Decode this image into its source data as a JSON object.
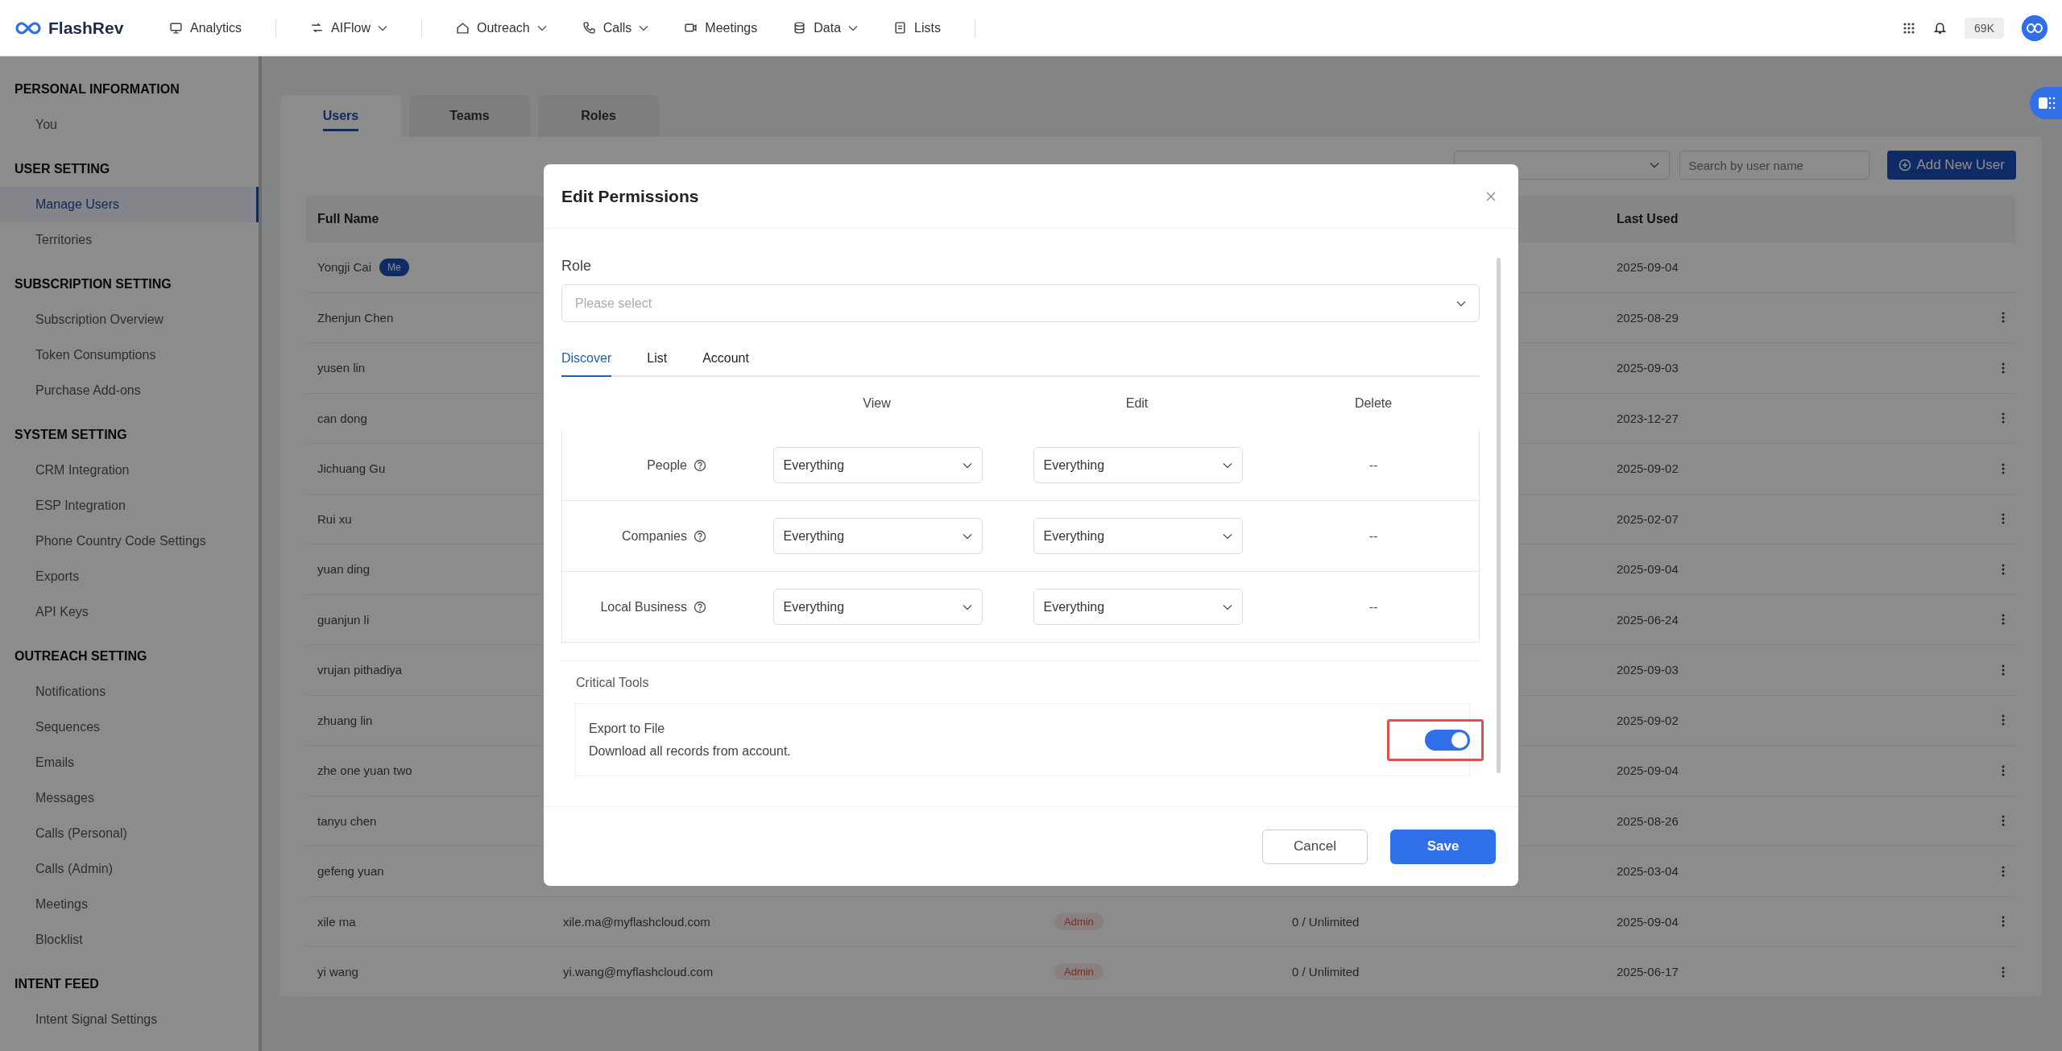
{
  "app": {
    "name": "FlashRev"
  },
  "nav": [
    {
      "kind": "monitor",
      "label": "Analytics",
      "dropdown": false,
      "divider_after": true
    },
    {
      "kind": "flow",
      "label": "AIFlow",
      "dropdown": true,
      "divider_after": true
    },
    {
      "kind": "house",
      "label": "Outreach",
      "dropdown": true,
      "divider_after": false
    },
    {
      "kind": "phone",
      "label": "Calls",
      "dropdown": true,
      "divider_after": false
    },
    {
      "kind": "video",
      "label": "Meetings",
      "dropdown": false,
      "divider_after": false
    },
    {
      "kind": "database",
      "label": "Data",
      "dropdown": true,
      "divider_after": false
    },
    {
      "kind": "list",
      "label": "Lists",
      "dropdown": false,
      "divider_after": true
    }
  ],
  "credits": "69K",
  "sidebar": [
    {
      "title": "PERSONAL INFORMATION",
      "items": [
        {
          "label": "You",
          "selected": false
        }
      ]
    },
    {
      "title": "USER SETTING",
      "items": [
        {
          "label": "Manage Users",
          "selected": true
        },
        {
          "label": "Territories",
          "selected": false
        }
      ]
    },
    {
      "title": "SUBSCRIPTION SETTING",
      "items": [
        {
          "label": "Subscription Overview",
          "selected": false
        },
        {
          "label": "Token Consumptions",
          "selected": false
        },
        {
          "label": "Purchase Add-ons",
          "selected": false
        }
      ]
    },
    {
      "title": "SYSTEM SETTING",
      "items": [
        {
          "label": "CRM Integration",
          "selected": false
        },
        {
          "label": "ESP Integration",
          "selected": false
        },
        {
          "label": "Phone Country Code Settings",
          "selected": false
        },
        {
          "label": "Exports",
          "selected": false
        },
        {
          "label": "API Keys",
          "selected": false
        }
      ]
    },
    {
      "title": "OUTREACH SETTING",
      "items": [
        {
          "label": "Notifications",
          "selected": false
        },
        {
          "label": "Sequences",
          "selected": false
        },
        {
          "label": "Emails",
          "selected": false
        },
        {
          "label": "Messages",
          "selected": false
        },
        {
          "label": "Calls (Personal)",
          "selected": false
        },
        {
          "label": "Calls (Admin)",
          "selected": false
        },
        {
          "label": "Meetings",
          "selected": false
        },
        {
          "label": "Blocklist",
          "selected": false
        }
      ]
    },
    {
      "title": "INTENT FEED",
      "items": [
        {
          "label": "Intent Signal Settings",
          "selected": false
        }
      ]
    }
  ],
  "tabs": [
    {
      "label": "Users",
      "selected": true
    },
    {
      "label": "Teams",
      "selected": false
    },
    {
      "label": "Roles",
      "selected": false
    }
  ],
  "toolbar": {
    "search": {
      "placeholder": "Search by user name"
    },
    "add_button": "Add New User"
  },
  "table": {
    "header": {
      "full_name": "Full Name",
      "last_used": "Last Used"
    },
    "rows": [
      {
        "full_name": "Yongji Cai",
        "badge": "Me",
        "last_used": "2025-09-04",
        "menu": false
      },
      {
        "full_name": "Zhenjun Chen",
        "last_used": "2025-08-29",
        "menu": true
      },
      {
        "full_name": "yusen lin",
        "last_used": "2025-09-03",
        "menu": true
      },
      {
        "full_name": "can dong",
        "last_used": "2023-12-27",
        "menu": true
      },
      {
        "full_name": "Jichuang Gu",
        "last_used": "2025-09-02",
        "menu": true
      },
      {
        "full_name": "Rui xu",
        "last_used": "2025-02-07",
        "menu": true
      },
      {
        "full_name": "yuan ding",
        "last_used": "2025-09-04",
        "menu": true
      },
      {
        "full_name": "guanjun li",
        "last_used": "2025-06-24",
        "menu": true
      },
      {
        "full_name": "vrujan pithadiya",
        "last_used": "2025-09-03",
        "menu": true
      },
      {
        "full_name": "zhuang lin",
        "last_used": "2025-09-02",
        "menu": true
      },
      {
        "full_name": "zhe one yuan two",
        "last_used": "2025-09-04",
        "menu": true
      },
      {
        "full_name": "tanyu chen",
        "last_used": "2025-08-26",
        "menu": true
      },
      {
        "full_name": "gefeng yuan",
        "last_used": "2025-03-04",
        "menu": true
      },
      {
        "full_name": "xile ma",
        "email": "xile.ma@myflashcloud.com",
        "role": "Admin",
        "tokens": "0 / Unlimited",
        "last_used": "2025-09-04",
        "menu": true
      },
      {
        "full_name": "yi wang",
        "email": "yi.wang@myflashcloud.com",
        "role": "Admin",
        "tokens": "0 / Unlimited",
        "last_used": "2025-06-17",
        "menu": true
      }
    ]
  },
  "modal": {
    "title": "Edit Permissions",
    "role": {
      "label": "Role",
      "placeholder": "Please select"
    },
    "tabs": [
      {
        "label": "Discover",
        "selected": true
      },
      {
        "label": "List",
        "selected": false
      },
      {
        "label": "Account",
        "selected": false
      }
    ],
    "permissions": {
      "columns": [
        "View",
        "Edit",
        "Delete"
      ],
      "rows": [
        {
          "label": "People",
          "view": "Everything",
          "edit": "Everything",
          "delete": "--"
        },
        {
          "label": "Companies",
          "view": "Everything",
          "edit": "Everything",
          "delete": "--"
        },
        {
          "label": "Local Business",
          "view": "Everything",
          "edit": "Everything",
          "delete": "--"
        }
      ]
    },
    "critical_tools": {
      "title": "Critical Tools",
      "items": [
        {
          "title": "Export to File",
          "description": "Download all records from account.",
          "on": true,
          "highlighted": true
        }
      ]
    },
    "cancel": "Cancel",
    "save": "Save"
  }
}
